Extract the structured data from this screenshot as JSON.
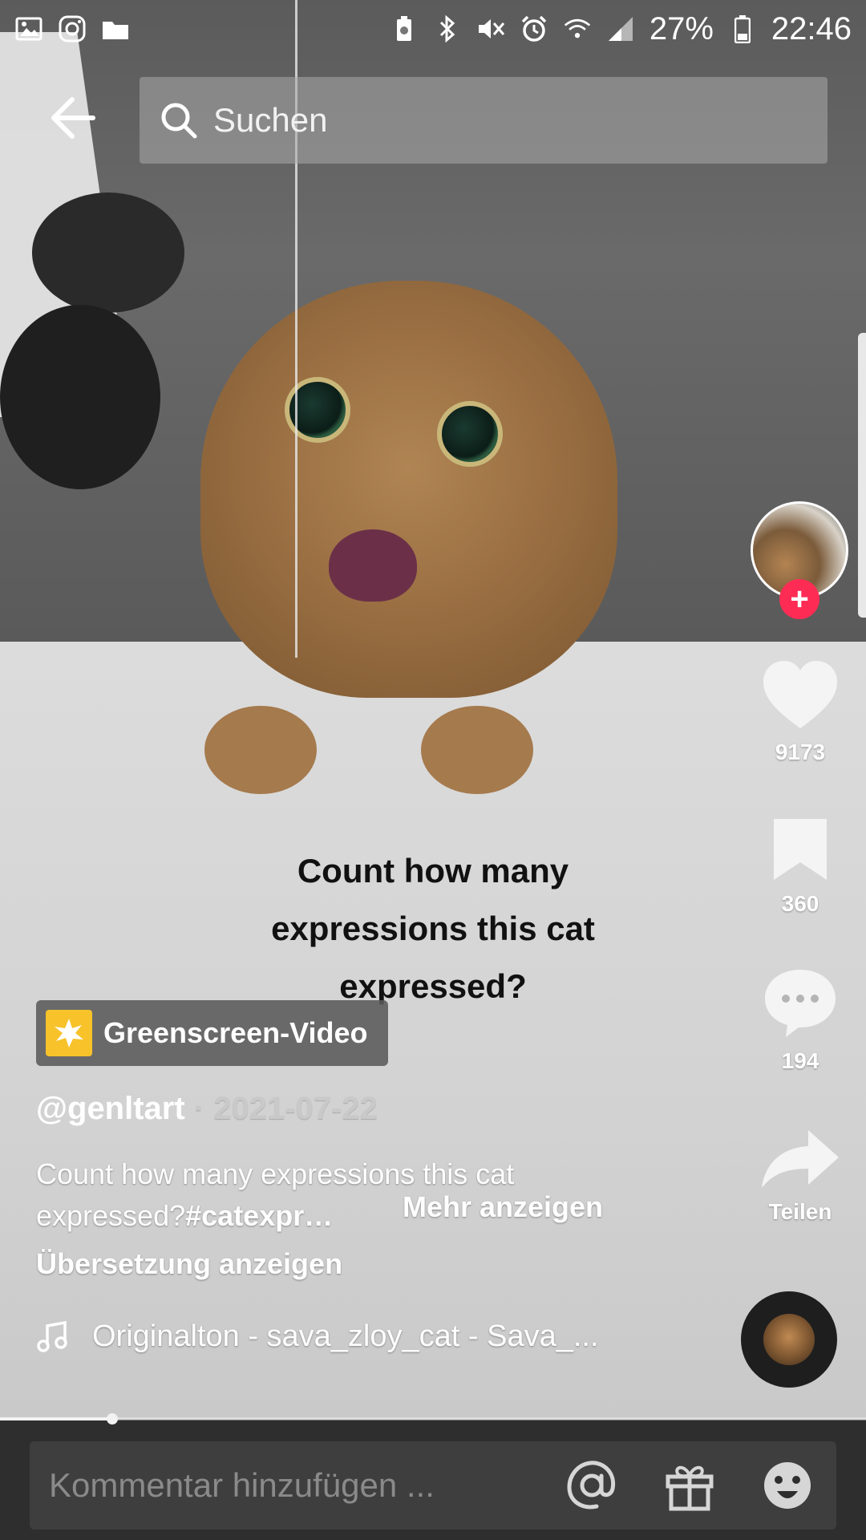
{
  "status_bar": {
    "battery": "27%",
    "time": "22:46",
    "left_icons": [
      "gallery-icon",
      "instagram-icon",
      "folder-icon"
    ],
    "right_icons": [
      "battery-saver-icon",
      "bluetooth-icon",
      "mute-icon",
      "alarm-icon",
      "wifi-icon",
      "signal-icon",
      "battery-icon"
    ]
  },
  "search": {
    "placeholder": "Suchen"
  },
  "video": {
    "caption": "Count how many expressions this cat expressed?"
  },
  "actions": {
    "likes": "9173",
    "saves": "360",
    "comments": "194",
    "share_label": "Teilen"
  },
  "info": {
    "greenscreen_label": "Greenscreen-Video",
    "username": "@genltart",
    "separator": " · ",
    "date": "2021-07-22",
    "description_text": "Count how many expressions this cat expressed?",
    "description_tag": "#catexpr…",
    "more_label": "Mehr anzeigen",
    "translate_label": "Übersetzung anzeigen",
    "sound": "Originalton - sava_zloy_cat - Sava_..."
  },
  "progress": {
    "fraction": 0.13
  },
  "comment": {
    "placeholder": "Kommentar hinzufügen ..."
  },
  "colors": {
    "accent": "#fe2c55",
    "greenscreen_icon": "#f7c22a"
  }
}
